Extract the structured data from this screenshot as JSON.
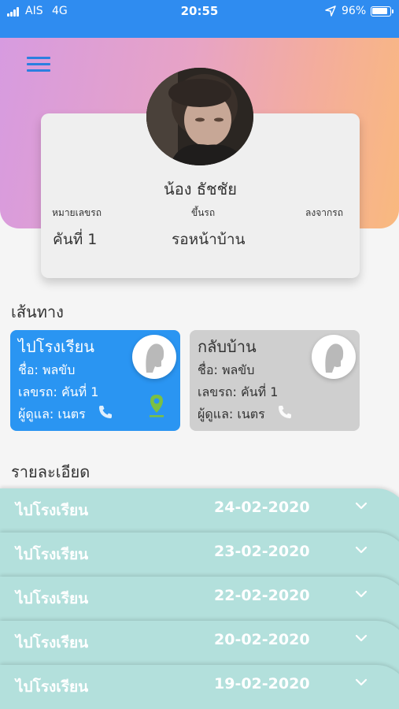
{
  "status_bar": {
    "carrier": "AIS",
    "network": "4G",
    "time": "20:55",
    "battery": "96%"
  },
  "header": {
    "menu_icon": "hamburger-menu-icon"
  },
  "profile": {
    "name": "น้อง ธัชชัย",
    "labels": {
      "bus_number": "หมายเลขรถ",
      "board": "ขึ้นรถ",
      "alight": "ลงจากรถ"
    },
    "values": {
      "bus_number": "คันที่ 1",
      "board": "รอหน้าบ้าน"
    }
  },
  "routes": {
    "title": "เส้นทาง",
    "items": [
      {
        "title": "ไปโรงเรียน",
        "driver": "ชื่อ: พลขับ",
        "bus": "เลขรถ: คันที่ 1",
        "caretaker": "ผู้ดูแล: เนตร",
        "active": true
      },
      {
        "title": "กลับบ้าน",
        "driver": "ชื่อ: พลขับ",
        "bus": "เลขรถ: คันที่ 1",
        "caretaker": "ผู้ดูแล: เนตร",
        "active": false
      }
    ]
  },
  "details": {
    "title": "รายละเอียด",
    "items": [
      {
        "label": "ไปโรงเรียน",
        "date": "24-02-2020"
      },
      {
        "label": "ไปโรงเรียน",
        "date": "23-02-2020"
      },
      {
        "label": "ไปโรงเรียน",
        "date": "22-02-2020"
      },
      {
        "label": "ไปโรงเรียน",
        "date": "20-02-2020"
      },
      {
        "label": "ไปโรงเรียน",
        "date": "19-02-2020"
      }
    ]
  },
  "colors": {
    "status_bar": "#2f8cf0",
    "active_route": "#2a95f2",
    "inactive_route": "#cfcfcf",
    "detail_row": "#b3e0dc",
    "pin": "#7bc043"
  }
}
